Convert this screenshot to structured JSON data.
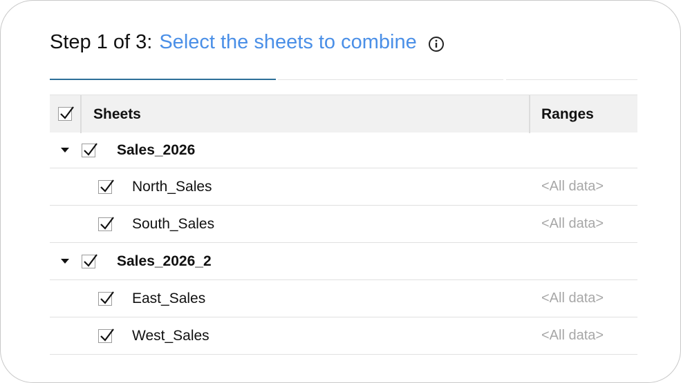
{
  "header": {
    "step_text": "Step 1 of 3",
    "separator": ":",
    "title_link": "Select the sheets to combine",
    "info_icon": "info-circle-icon",
    "link_color": "#4a8fe7"
  },
  "progress": {
    "steps_total": 3,
    "current_step": 1,
    "active_color": "#2d6f98",
    "inactive_color": "#e2e2e2"
  },
  "table": {
    "select_all_checked": true,
    "columns": {
      "sheets": "Sheets",
      "ranges": "Ranges"
    },
    "groups": [
      {
        "name": "Sales_2026",
        "checked": true,
        "expanded": true,
        "sheets": [
          {
            "name": "North_Sales",
            "range": "<All data>",
            "checked": true
          },
          {
            "name": "South_Sales",
            "range": "<All data>",
            "checked": true
          }
        ]
      },
      {
        "name": "Sales_2026_2",
        "checked": true,
        "expanded": true,
        "sheets": [
          {
            "name": "East_Sales",
            "range": "<All data>",
            "checked": true
          },
          {
            "name": "West_Sales",
            "range": "<All data>",
            "checked": true
          }
        ]
      }
    ]
  }
}
